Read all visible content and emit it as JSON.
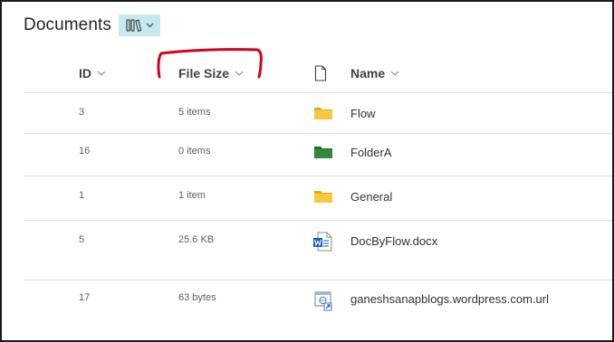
{
  "header": {
    "title": "Documents"
  },
  "columns": {
    "id": "ID",
    "file_size": "File Size",
    "name": "Name"
  },
  "rows": [
    {
      "id": "3",
      "size": "5 items",
      "name": "Flow",
      "type": "folder"
    },
    {
      "id": "16",
      "size": "0 items",
      "name": "FolderA",
      "type": "folder-green"
    },
    {
      "id": "1",
      "size": "1 item",
      "name": "General",
      "type": "folder"
    },
    {
      "id": "5",
      "size": "25.6 KB",
      "name": "DocByFlow.docx",
      "type": "word-doc"
    },
    {
      "id": "17",
      "size": "63 bytes",
      "name": "ganeshsanapblogs.wordpress.com.url",
      "type": "url-link"
    }
  ],
  "icons": {
    "view_switcher": "library-view-icon",
    "sort": "chevron-down-icon",
    "file_type_header": "file-icon"
  },
  "colors": {
    "folder_yellow": "#f5c23e",
    "folder_green": "#2e8b3a",
    "word_blue": "#185abd",
    "annotation_red": "#d0021b",
    "view_switcher_bg": "#c7e8ef"
  }
}
